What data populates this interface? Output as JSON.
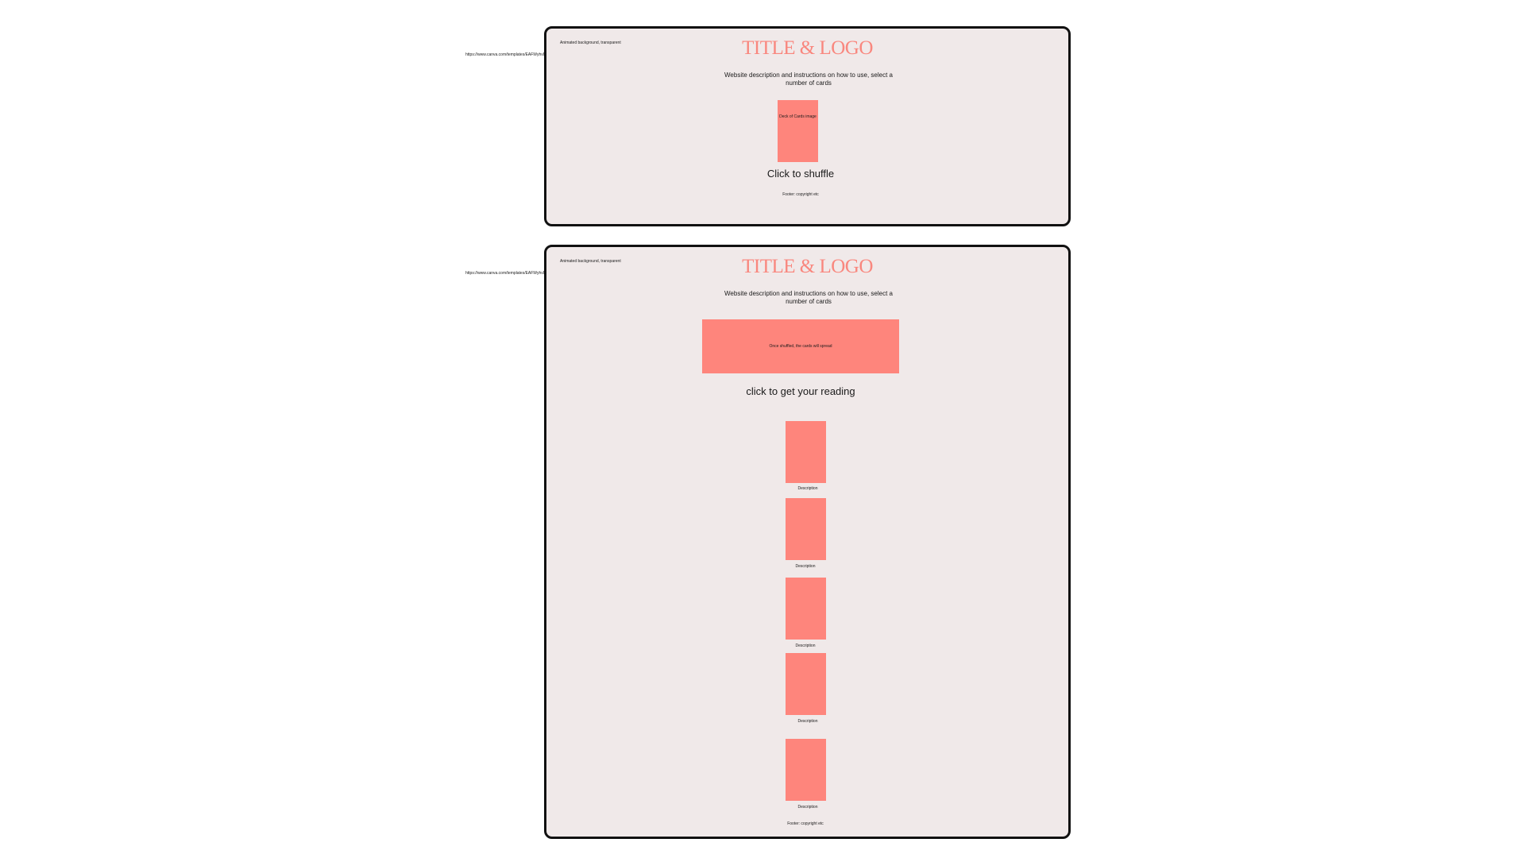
{
  "frame_1": {
    "note": "Animated background, transparent",
    "url": "https://www.canva.com/templates/EAFWyhvDE-white-black-minimal-wireframe-abstract-mystical-astrology-instagram-post/",
    "title": "TITLE & LOGO",
    "description": "Website description and instructions on how to use, select a number of cards",
    "deck_image_label": "Deck of Cards image",
    "shuffle_label": "Click to shuffle",
    "footer": "Footer: copyright etc"
  },
  "frame_2": {
    "note": "Animated background, transparent",
    "url": "https://www.canva.com/templates/EAFWyhvDE-white-black-minimal-wireframe-abstract-mystical-astrology-instagram-post/",
    "title": "TITLE & LOGO",
    "description": "Website description and instructions on how to use, select a number of cards",
    "spread_label": "Once shuffled, the cards will spread",
    "reading_label": "click to get your reading",
    "cards": [
      {
        "description": "Description"
      },
      {
        "description": "Description"
      },
      {
        "description": "Description"
      },
      {
        "description": "Description"
      },
      {
        "description": "Description"
      }
    ],
    "footer": "Footer: copyright etc"
  },
  "colors": {
    "frame_background": "#f0e9e9",
    "frame_border": "#111111",
    "accent_salmon": "#fe857c",
    "title_color": "#f9877e"
  }
}
